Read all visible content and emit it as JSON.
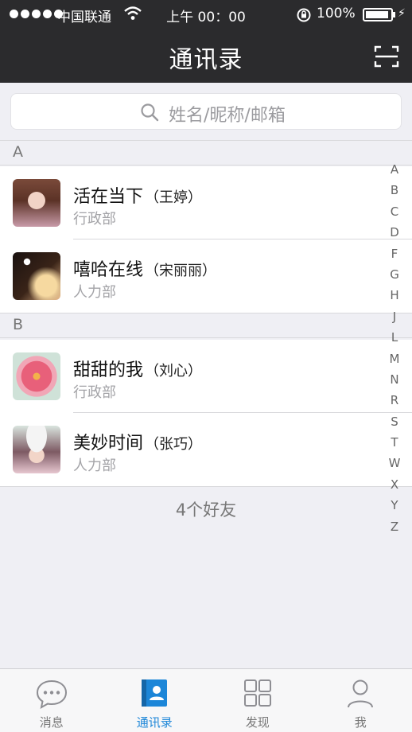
{
  "status_bar": {
    "carrier": "中国联通",
    "time": "上午 00：00",
    "battery": "100%"
  },
  "nav": {
    "title": "通讯录"
  },
  "search": {
    "placeholder": "姓名/昵称/邮箱"
  },
  "sections": [
    {
      "letter": "A",
      "contacts": [
        {
          "nickname": "活在当下",
          "real_name": "（王婷）",
          "department": "行政部"
        },
        {
          "nickname": "嘻哈在线",
          "real_name": "（宋丽丽）",
          "department": "人力部"
        }
      ]
    },
    {
      "letter": "B",
      "contacts": [
        {
          "nickname": "甜甜的我",
          "real_name": "（刘心）",
          "department": "行政部"
        },
        {
          "nickname": "美妙时间",
          "real_name": "（张巧）",
          "department": "人力部"
        }
      ]
    }
  ],
  "index_letters": [
    "A",
    "B",
    "C",
    "D",
    "F",
    "G",
    "H",
    "J",
    "L",
    "M",
    "N",
    "R",
    "S",
    "T",
    "W",
    "X",
    "Y",
    "Z"
  ],
  "friend_count": "4个好友",
  "tabs": [
    {
      "label": "消息",
      "icon": "chat-bubble-icon",
      "active": false
    },
    {
      "label": "通讯录",
      "icon": "contacts-book-icon",
      "active": true
    },
    {
      "label": "发现",
      "icon": "grid-icon",
      "active": false
    },
    {
      "label": "我",
      "icon": "person-icon",
      "active": false
    }
  ],
  "colors": {
    "nav_bg": "#2b2b2d",
    "accent": "#1c86d8",
    "page_bg": "#efeff4"
  }
}
